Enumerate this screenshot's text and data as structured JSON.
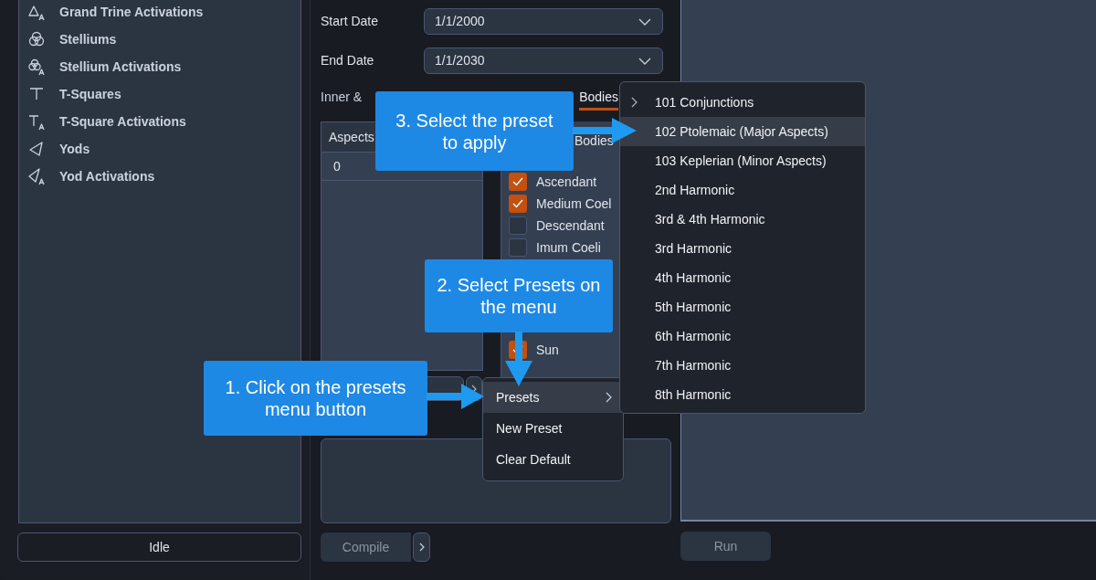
{
  "sidebar": {
    "items": [
      {
        "label": "Grand Trine Activations"
      },
      {
        "label": "Stelliums"
      },
      {
        "label": "Stellium Activations"
      },
      {
        "label": "T-Squares"
      },
      {
        "label": "T-Square Activations"
      },
      {
        "label": "Yods"
      },
      {
        "label": "Yod Activations"
      }
    ],
    "status_button": {
      "label": "Idle",
      "disabled": false
    }
  },
  "form": {
    "fields": [
      {
        "label": "Start Date",
        "value": "1/1/2000"
      },
      {
        "label": "End Date",
        "value": "1/1/2030"
      }
    ]
  },
  "tabs": [
    {
      "label": "Inner &",
      "selected": false
    },
    {
      "label": "Bodies",
      "selected": true
    }
  ],
  "aspects_table": {
    "column": "Aspects",
    "rows": [
      "0"
    ]
  },
  "bodies_list": {
    "column": "Bodies",
    "upper_items": [
      {
        "label": "Ascendant",
        "checked": true
      },
      {
        "label": "Medium Coel",
        "checked": true
      },
      {
        "label": "Descendant",
        "checked": false
      },
      {
        "label": "Imum Coeli",
        "checked": false
      }
    ],
    "lower_items": [
      {
        "label": "Sun",
        "checked": true
      }
    ]
  },
  "compile_button": {
    "label": "Compile",
    "disabled": true
  },
  "run_button": {
    "label": "Run",
    "disabled": true
  },
  "context_menu": {
    "items": [
      {
        "label": "Presets",
        "submenu": true,
        "selected": true
      },
      {
        "label": "New Preset",
        "submenu": false,
        "selected": false
      },
      {
        "label": "Clear Default",
        "submenu": false,
        "selected": false
      }
    ]
  },
  "presets_submenu": {
    "items": [
      {
        "label": "101 Conjunctions",
        "chevron": true,
        "selected": false
      },
      {
        "label": "102 Ptolemaic (Major Aspects)",
        "chevron": false,
        "selected": true
      },
      {
        "label": "103 Keplerian (Minor Aspects)",
        "chevron": false,
        "selected": false
      },
      {
        "label": "2nd Harmonic",
        "chevron": false,
        "selected": false
      },
      {
        "label": "3rd & 4th Harmonic",
        "chevron": false,
        "selected": false
      },
      {
        "label": "3rd Harmonic",
        "chevron": false,
        "selected": false
      },
      {
        "label": "4th Harmonic",
        "chevron": false,
        "selected": false
      },
      {
        "label": "5th Harmonic",
        "chevron": false,
        "selected": false
      },
      {
        "label": "6th Harmonic",
        "chevron": false,
        "selected": false
      },
      {
        "label": "7th Harmonic",
        "chevron": false,
        "selected": false
      },
      {
        "label": "8th Harmonic",
        "chevron": false,
        "selected": false
      }
    ]
  },
  "callouts": [
    {
      "text": "3. Select the preset to apply"
    },
    {
      "text": "2. Select Presets on the menu"
    },
    {
      "text": "1. Click on the presets menu button"
    }
  ]
}
